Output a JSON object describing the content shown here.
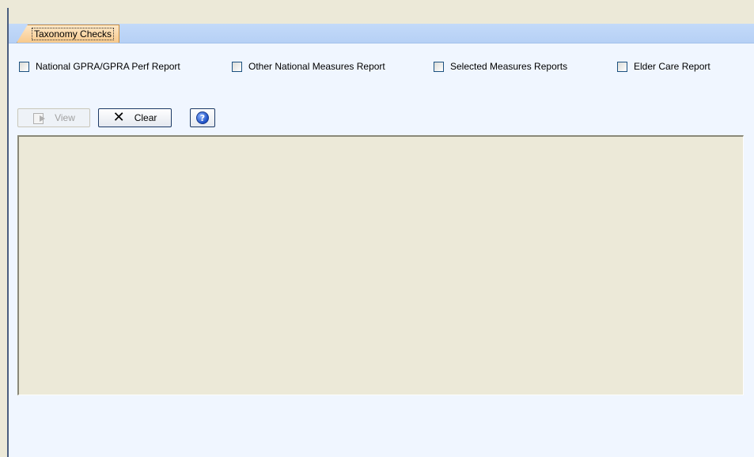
{
  "tabs": [
    {
      "label": "Taxonomy Checks",
      "active": true
    }
  ],
  "report_options": [
    {
      "label": "National GPRA/GPRA Perf Report",
      "checked": false
    },
    {
      "label": "Other National Measures Report",
      "checked": false
    },
    {
      "label": "Selected Measures Reports",
      "checked": false
    },
    {
      "label": "Elder Care Report",
      "checked": false
    }
  ],
  "toolbar": {
    "view_label": "View",
    "view_enabled": false,
    "clear_label": "Clear",
    "help_glyph": "?"
  },
  "icons": {
    "view": "view-document-arrow-icon",
    "clear": "x-icon",
    "help": "help-icon"
  },
  "colors": {
    "tab_strip": "#c3daf9",
    "active_tab": "#f8c98c",
    "content_bg": "#f0f6ff",
    "panel_bg": "#ece9d8"
  }
}
